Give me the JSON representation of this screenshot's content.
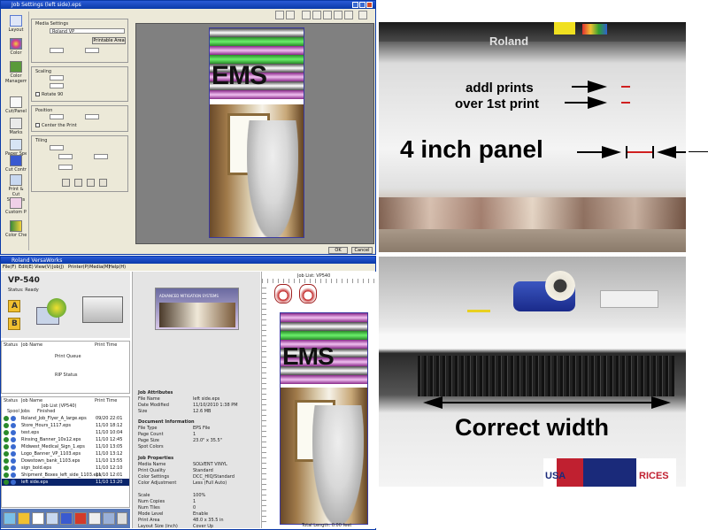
{
  "job_settings": {
    "title": "Job Settings (left side).eps",
    "sidebar_items": [
      "Layout",
      "Color",
      "Color Management",
      "Cut/Panel",
      "Marks",
      "Paper Special",
      "Cut Control",
      "Print & Cut Settings",
      "Custom Page",
      "Color Check"
    ],
    "groups": {
      "media": "Media Settings",
      "scaling": "Scaling",
      "position": "Position",
      "tiling": "Tiling"
    },
    "checkbox_center": "Center the Print",
    "checkbox_rotate": "Rotate 90",
    "media_value": "Roland VP",
    "media_button": "Printable Area",
    "ok": "OK",
    "cancel": "Cancel",
    "preview_text": "EMS"
  },
  "versaworks": {
    "title": "Roland VersaWorks",
    "menu": [
      "File(F)",
      "Edit(E)",
      "View(V)",
      "Job(J)",
      "Printer(P)",
      "Media(M)",
      "Help(H)"
    ],
    "printer_name": "VP-540",
    "printer_status": "Status: Ready",
    "queue_a": "A",
    "queue_b": "B",
    "col_status": "Status",
    "col_job_name": "Job Name",
    "col_print_time": "Print Time",
    "print_queue_label": "Print Queue",
    "rip_status_label": "RIP Status",
    "job_list_label": "Job List (VP540)",
    "job_tabs": [
      "Spool Jobs",
      "Finished"
    ],
    "jobs": [
      "Roland_Job_Flyer_A_large.eps",
      "Store_Hours_1117.eps",
      "test.eps",
      "Rinsing_Banner_10x12.eps",
      "Midwest_Medical_Sign_1.eps",
      "Logo_Banner_VP_1103.eps",
      "Dowstown_bank_1103.eps",
      "sign_bold.eps",
      "Shipment_Boxes_left_side_1103.eps",
      "left side.eps"
    ],
    "job_times": [
      "09/20 22:01",
      "11/10 18:12",
      "11/10 10:04",
      "11/10 12:45",
      "11/10 13:05",
      "11/10 13:12",
      "11/10 13:55",
      "11/10 12:10",
      "11/10 12:01",
      "11/10 13:20"
    ],
    "job_info_heading": "Job Attributes",
    "job_info": [
      [
        "File Name",
        "left side.eps"
      ],
      [
        "Date Modified",
        "11/10/2010 1:38 PM"
      ],
      [
        "Size",
        "12.6 MB"
      ]
    ],
    "doc_heading": "Document Information",
    "doc_info": [
      [
        "File Type",
        "EPS File"
      ],
      [
        "Page Count",
        "1"
      ],
      [
        "Page Size",
        "23.0\" x 35.5\""
      ],
      [
        "Spot Colors",
        ""
      ]
    ],
    "props_heading": "Job Properties",
    "props": [
      [
        "Media Name",
        "SOLVENT VINYL"
      ],
      [
        "Print Quality",
        "Standard"
      ],
      [
        "Color Settings",
        "DCC_HIQ/Standard"
      ],
      [
        "Color Adjustment",
        "Less (Full Auto)"
      ],
      [
        "",
        ""
      ],
      [
        "Scale",
        "100%"
      ],
      [
        "Num Copies",
        "1"
      ],
      [
        "Num Tiles",
        "0"
      ],
      [
        "Mode Level",
        "Enable"
      ],
      [
        "Print Area",
        "48.0 x 35.5 in"
      ],
      [
        "Layout Size (inch)",
        "Cover Up"
      ]
    ],
    "preview_text": "EMS",
    "preview_label": "Job List: VP540",
    "status_bar": "Total Length: 0.00 feet",
    "thumb_caption": "ADVANCED MITIGATION SYSTEMS"
  },
  "photo_top": {
    "brand": "Roland",
    "caption_1": "addl prints",
    "caption_2": "over 1st print",
    "caption_3": "4 inch panel"
  },
  "photo_bottom": {
    "caption": "Correct width",
    "sign_letters": "USA",
    "sign_letters_2": "RICES"
  }
}
